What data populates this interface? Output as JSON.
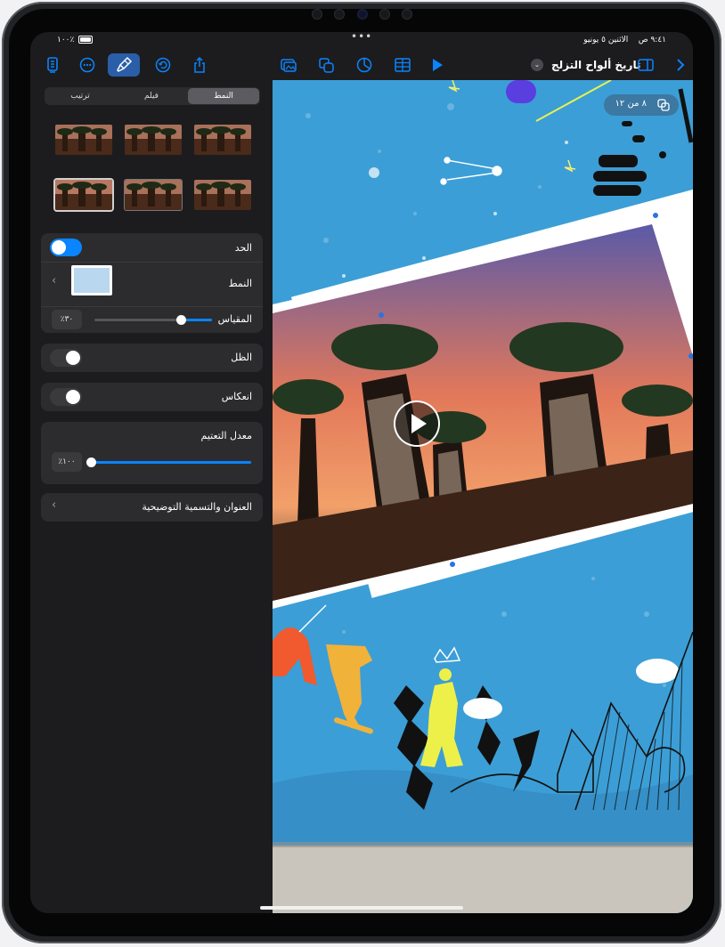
{
  "status": {
    "time": "٩:٤١ ص",
    "date": "الاثنين ٥ يونيو",
    "battery": "٪١٠٠"
  },
  "toolbar": {
    "document_title": "تاريخ ألواح التزلج",
    "left_icons": [
      "document-icon",
      "more-icon",
      "format-brush-icon",
      "undo-icon",
      "share-icon"
    ],
    "center_icons": [
      "media-icon",
      "shapes-icon",
      "chart-icon",
      "table-icon",
      "play-icon"
    ],
    "right_icons": [
      "sidebar-icon",
      "chevron-right-icon"
    ]
  },
  "panel": {
    "tabs": [
      "ترتيب",
      "فيلم",
      "النمط"
    ],
    "selected_tab": "النمط",
    "border_label": "الحد",
    "border_on": true,
    "style_label": "النمط",
    "scale_label": "المقياس",
    "scale_value": "٪٣٠",
    "scale_level": 0.22,
    "shadow_label": "الظل",
    "shadow_on": false,
    "reflection_label": "انعكاس",
    "reflection_on": false,
    "opacity_label": "معدل التعتيم",
    "opacity_value": "٪١٠٠",
    "opacity_level": 1.0,
    "caption_label": "العنوان والتسمية التوضيحية"
  },
  "canvas": {
    "slide_counter": "٨ من ١٢"
  },
  "colors": {
    "accent": "#0a84ff",
    "panel_bg": "#1c1c1e",
    "group_bg": "#2c2c2e",
    "wall_blue": "#3c9ed6"
  }
}
